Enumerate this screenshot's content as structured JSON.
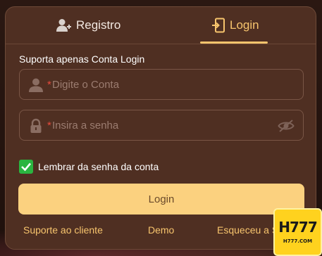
{
  "tabs": {
    "registro": {
      "label": "Registro",
      "icon": "user-plus-icon"
    },
    "login": {
      "label": "Login",
      "icon": "door-enter-icon",
      "active": true
    }
  },
  "form": {
    "subtitle": "Suporta apenas Conta Login",
    "account": {
      "required_mark": "*",
      "placeholder": "Digite o Conta",
      "icon": "user-icon"
    },
    "password": {
      "required_mark": "*",
      "placeholder": "Insira a senha",
      "icon": "lock-icon",
      "toggle_icon": "eye-off-icon"
    },
    "remember": {
      "label": "Lembrar da senha da conta",
      "checked": true
    },
    "submit_label": "Login"
  },
  "links": {
    "support": "Suporte ao cliente",
    "demo": "Demo",
    "forgot": "Esqueceu a S"
  },
  "brand": {
    "mark": "H777",
    "sub": "H777.COM"
  },
  "colors": {
    "panel": "#4f2f22",
    "accent": "#f7c46d",
    "button": "#fbd17f",
    "checkbox": "#2ab540",
    "required": "#e64a3c"
  }
}
